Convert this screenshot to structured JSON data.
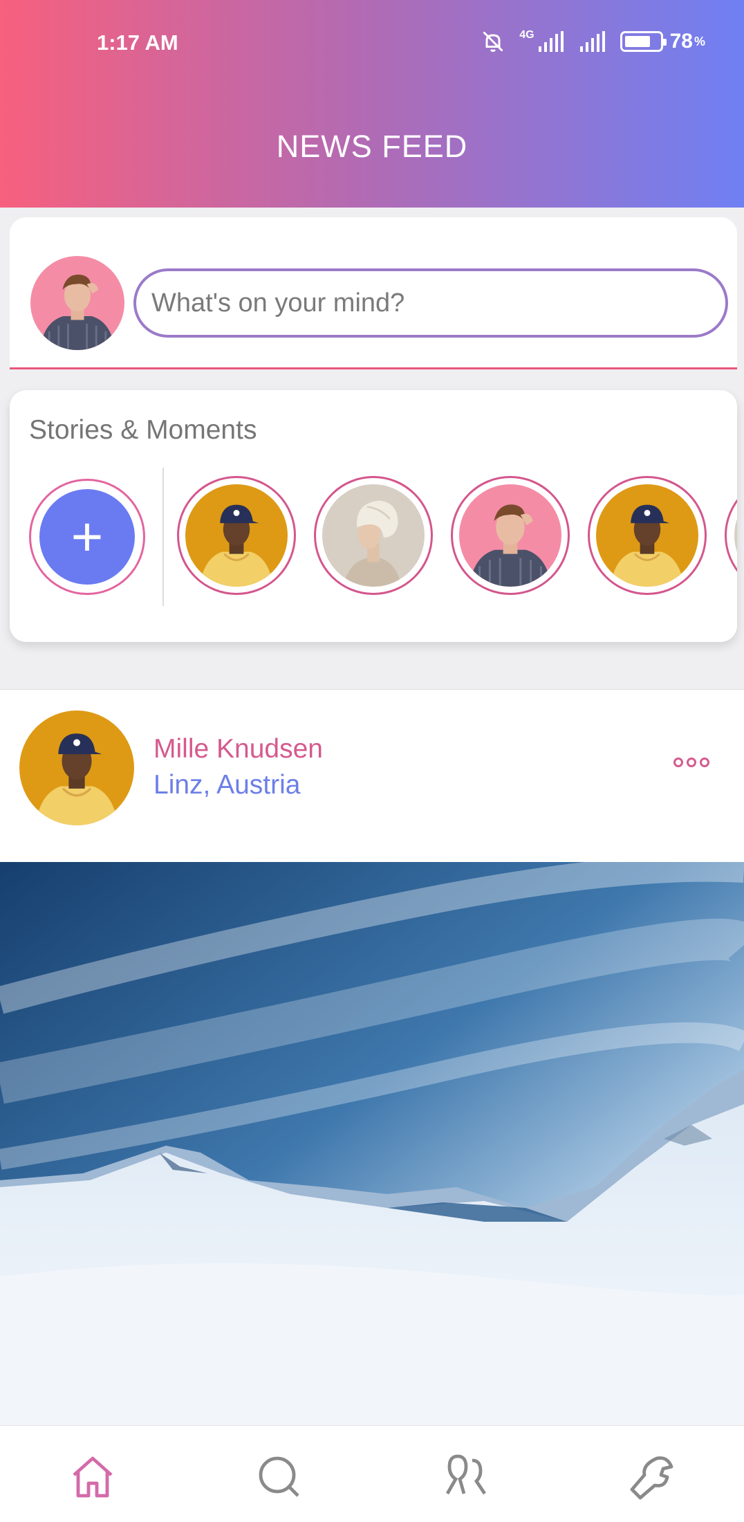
{
  "status_bar": {
    "time": "1:17 AM",
    "network": "4G",
    "battery_percent": "78",
    "battery_unit": "%",
    "battery_level": 0.78
  },
  "header": {
    "title": "NEWS FEED"
  },
  "composer": {
    "placeholder": "What's on your mind?"
  },
  "stories": {
    "title": "Stories & Moments",
    "add_icon": "plus-icon",
    "items": [
      "man-yellow-cap",
      "woman-white-turban",
      "man-pink-bg",
      "man-yellow-cap",
      "partial"
    ]
  },
  "post": {
    "author": "Mille Knudsen",
    "location": "Linz, Austria",
    "menu_icon": "more-horizontal-icon",
    "image": "snowy-mountains-landscape"
  },
  "bottom_nav": {
    "items": [
      "home-icon",
      "search-icon",
      "friends-icon",
      "settings-wrench-icon"
    ]
  },
  "colors": {
    "gradient_start": "#f7607e",
    "gradient_end": "#6f80f3",
    "accent_pink": "#d55a8f",
    "accent_blue": "#6d7fe7",
    "input_border": "#9b7ac9"
  }
}
